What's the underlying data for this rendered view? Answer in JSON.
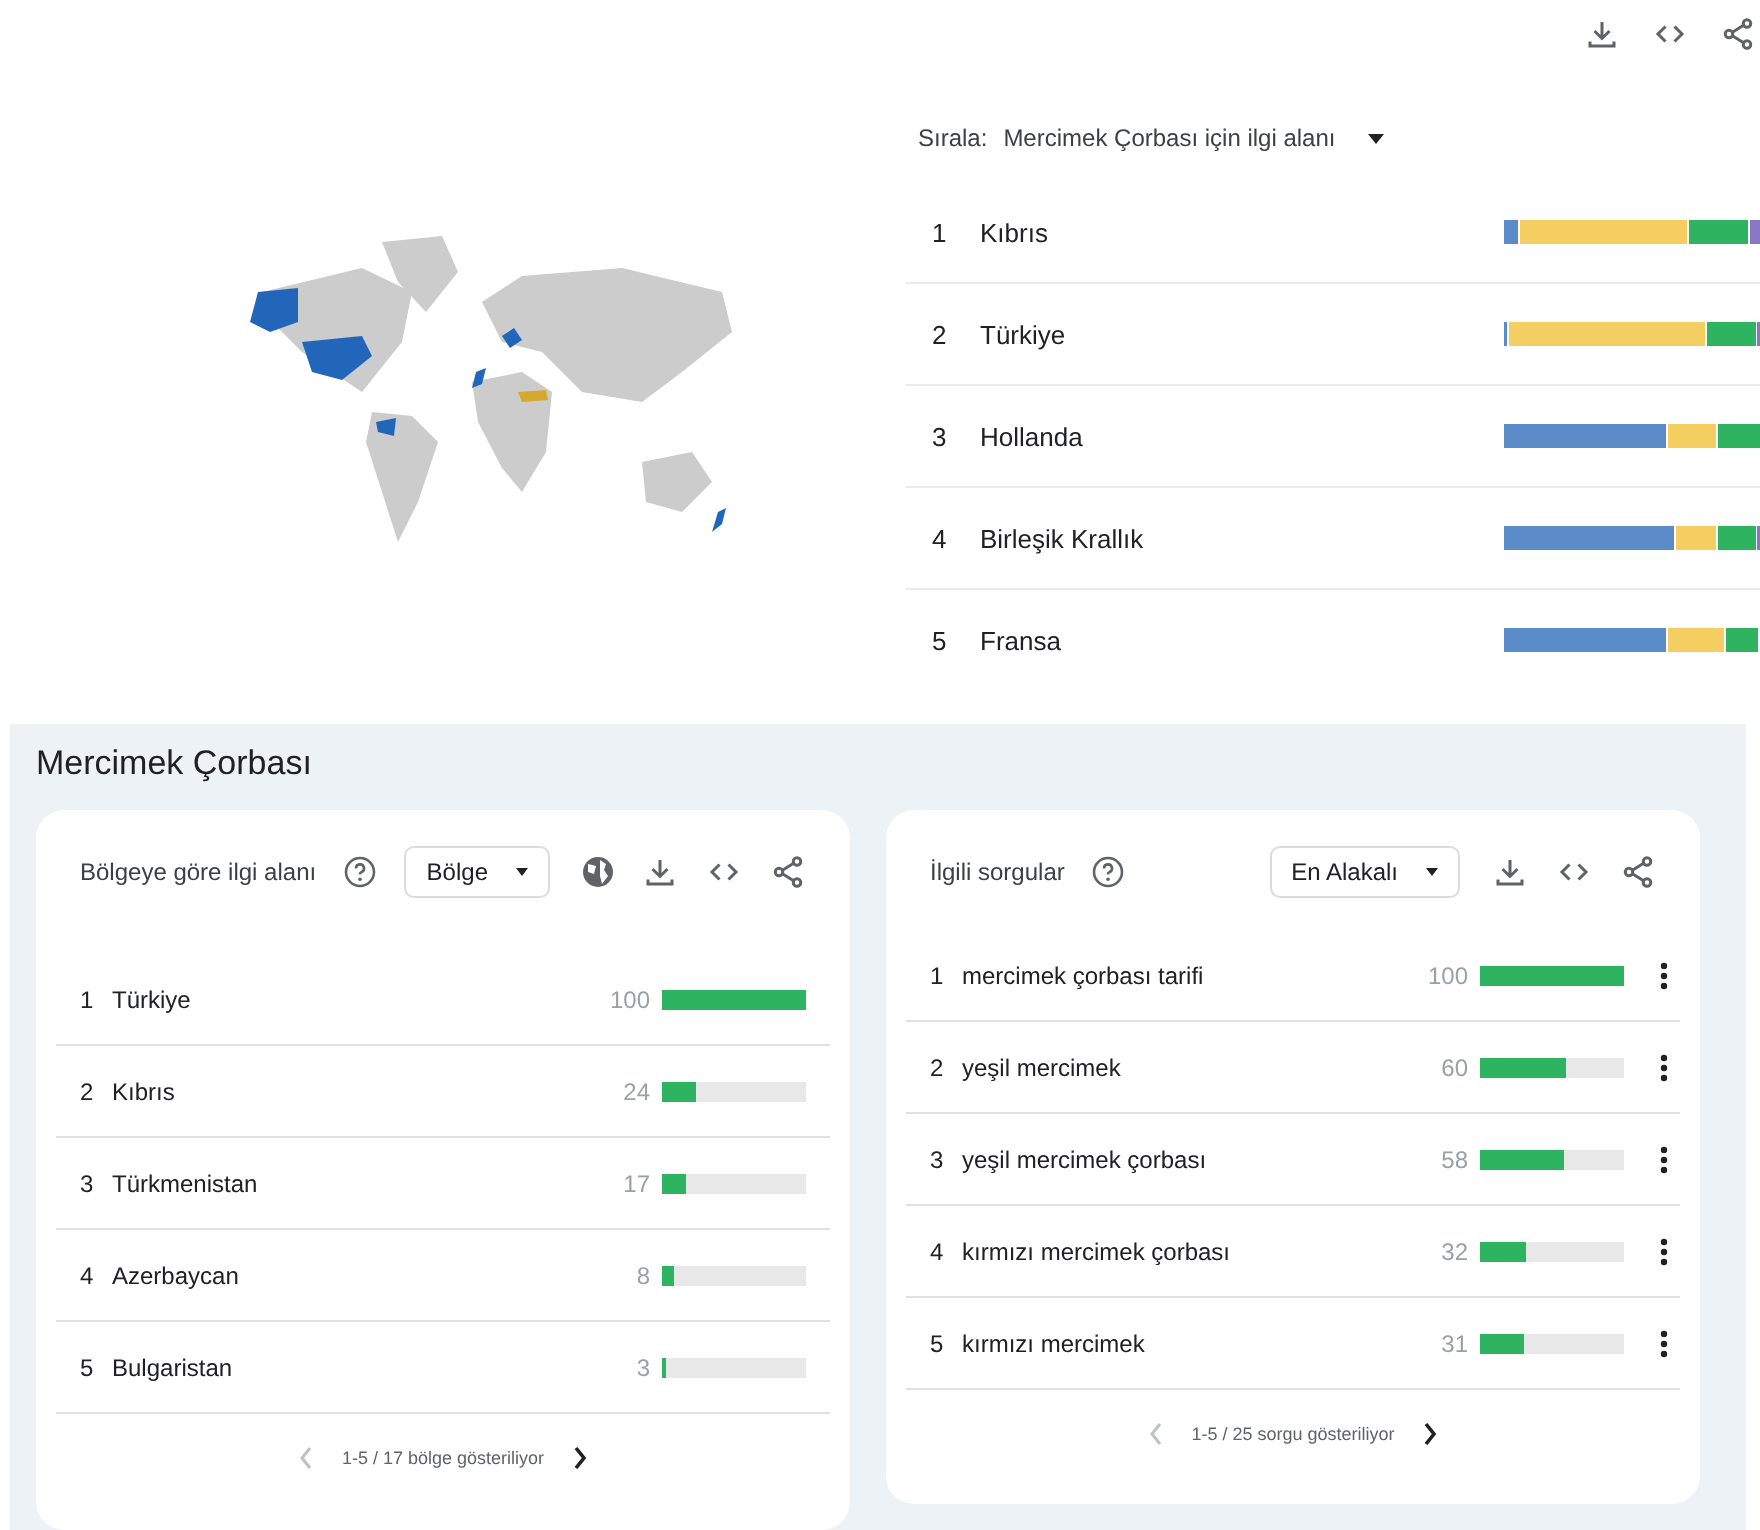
{
  "sort": {
    "label": "Sırala:",
    "value": "Mercimek Çorbası için ilgi alanı"
  },
  "countries": [
    {
      "rank": "1",
      "name": "Kıbrıs"
    },
    {
      "rank": "2",
      "name": "Türkiye"
    },
    {
      "rank": "3",
      "name": "Hollanda"
    },
    {
      "rank": "4",
      "name": "Birleşik Krallık"
    },
    {
      "rank": "5",
      "name": "Fransa"
    }
  ],
  "section": {
    "title": "Mercimek Çorbası"
  },
  "cards": [
    {
      "kind": "regions",
      "title": "Bölgeye göre ilgi alanı",
      "dropdown": "Bölge",
      "rows": [
        {
          "rank": "1",
          "label": "Türkiye",
          "value": "100",
          "level": 1.0
        },
        {
          "rank": "2",
          "label": "Kıbrıs",
          "value": "24",
          "level": 0.24
        },
        {
          "rank": "3",
          "label": "Türkmenistan",
          "value": "17",
          "level": 0.17
        },
        {
          "rank": "4",
          "label": "Azerbaycan",
          "value": "8",
          "level": 0.08
        },
        {
          "rank": "5",
          "label": "Bulgaristan",
          "value": "3",
          "level": 0.03
        }
      ],
      "pagination": "1-5 / 17 bölge gösteriliyor"
    },
    {
      "kind": "queries",
      "title": "İlgili sorgular",
      "dropdown": "En Alakalı",
      "rows": [
        {
          "rank": "1",
          "label": "mercimek çorbası tarifi",
          "value": "100",
          "level": 1.0
        },
        {
          "rank": "2",
          "label": "yeşil mercimek",
          "value": "60",
          "level": 0.6
        },
        {
          "rank": "3",
          "label": "yeşil mercimek çorbası",
          "value": "58",
          "level": 0.58
        },
        {
          "rank": "4",
          "label": "kırmızı mercimek çorbası",
          "value": "32",
          "level": 0.32
        },
        {
          "rank": "5",
          "label": "kırmızı mercimek",
          "value": "31",
          "level": 0.31
        }
      ],
      "pagination": "1-5 / 25 sorgu gösteriliyor"
    }
  ]
}
